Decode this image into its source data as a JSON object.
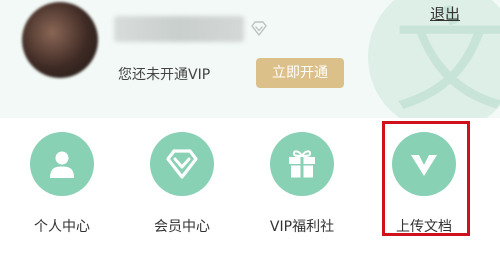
{
  "header": {
    "logout_label": "退出",
    "vip_status": "您还未开通VIP",
    "activate_vip_label": "立即开通",
    "watermark_glyph": "文"
  },
  "nav": {
    "items": [
      {
        "label": "个人中心",
        "icon": "user-icon"
      },
      {
        "label": "会员中心",
        "icon": "diamond-icon"
      },
      {
        "label": "VIP福利社",
        "icon": "gift-icon"
      },
      {
        "label": "上传文档",
        "icon": "v-icon"
      }
    ]
  },
  "colors": {
    "accent_green": "#88d1b4",
    "header_bg": "#f2f9f6",
    "vip_gold": "#dcc089",
    "highlight_red": "#d0111b"
  }
}
